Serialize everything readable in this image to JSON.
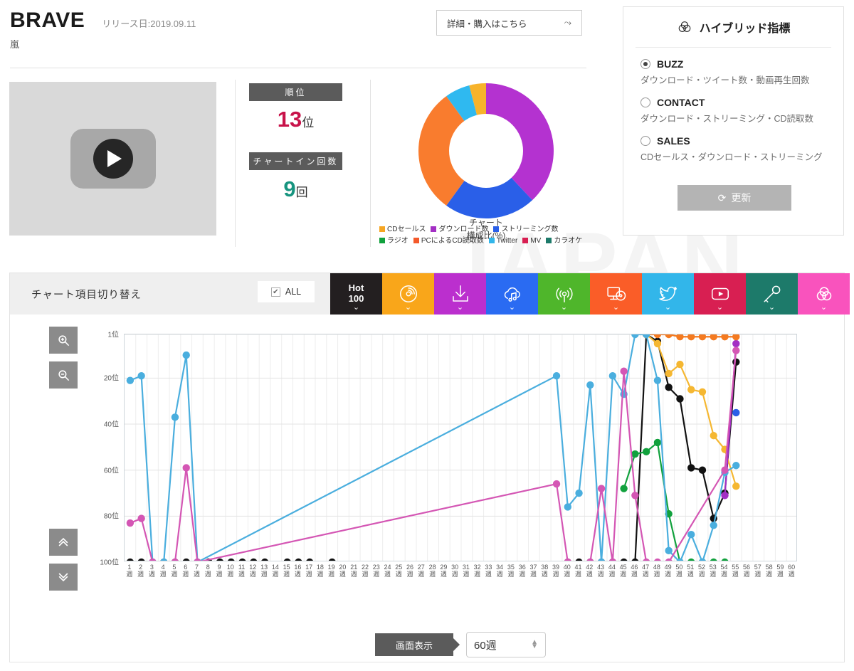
{
  "header": {
    "song_title": "BRAVE",
    "release_label": "リリース日:2019.09.11",
    "artist": "嵐",
    "buy_button": "詳細・購入はこちら",
    "buy_arrow": "⤳"
  },
  "stats": {
    "rank_label": "順位",
    "rank_number": "13",
    "rank_unit": "位",
    "chartin_label": "チャートイン回数",
    "chartin_number": "9",
    "chartin_unit": "回"
  },
  "donut": {
    "center_line1": "チャート",
    "center_line2": "構成比(%)"
  },
  "hybrid": {
    "title": "ハイブリッド指標",
    "options": [
      {
        "label": "BUZZ",
        "desc": "ダウンロード・ツイート数・動画再生回数",
        "selected": true
      },
      {
        "label": "CONTACT",
        "desc": "ダウンロード・ストリーミング・CD読取数",
        "selected": false
      },
      {
        "label": "SALES",
        "desc": "CDセールス・ダウンロード・ストリーミング",
        "selected": false
      }
    ],
    "update_button": "更新"
  },
  "panel": {
    "title": "チャート項目切り替え",
    "all_label": "ALL",
    "tabs": [
      {
        "name": "hot100",
        "caption": "Hot\n100",
        "icon": "hot100-icon",
        "color": "#231f20"
      },
      {
        "name": "cdsales",
        "caption": "",
        "icon": "record-icon",
        "color": "#f9a61a"
      },
      {
        "name": "download",
        "caption": "",
        "icon": "download-icon",
        "color": "#bb2fce"
      },
      {
        "name": "streaming",
        "caption": "",
        "icon": "cloud-music-icon",
        "color": "#2a6bf2"
      },
      {
        "name": "radio",
        "caption": "",
        "icon": "radio-icon",
        "color": "#4fb62b"
      },
      {
        "name": "pccd",
        "caption": "",
        "icon": "pc-cd-icon",
        "color": "#fa5d28"
      },
      {
        "name": "twitter",
        "caption": "",
        "icon": "twitter-icon",
        "color": "#32b6ea"
      },
      {
        "name": "mv",
        "caption": "",
        "icon": "youtube-icon",
        "color": "#d81f52"
      },
      {
        "name": "karaoke",
        "caption": "",
        "icon": "microphone-icon",
        "color": "#1d7a6a"
      },
      {
        "name": "hybrid",
        "caption": "",
        "icon": "venn-icon",
        "color": "#f953bd"
      }
    ],
    "zoom_in": "zoom-in",
    "zoom_out": "zoom-out",
    "scroll_up": "⌃⌃",
    "scroll_down": "⌄⌄",
    "pager_first": "«",
    "pager_prev": "‹",
    "pager_next": "›",
    "pager_last": "»",
    "display_label": "画面表示",
    "display_value": "60週"
  },
  "chart_data": {
    "type": "line",
    "title": "",
    "xlabel": "",
    "ylabel": "",
    "grid": true,
    "legend_position": "above (tab strip)",
    "ylim": [
      1,
      100
    ],
    "y_inverted": true,
    "yticks": [
      1,
      20,
      40,
      60,
      80,
      100
    ],
    "ytick_labels": [
      "1位",
      "20位",
      "40位",
      "60位",
      "80位",
      "100位"
    ],
    "x": [
      1,
      2,
      3,
      4,
      5,
      6,
      7,
      8,
      9,
      10,
      11,
      12,
      13,
      14,
      15,
      16,
      17,
      18,
      19,
      20,
      21,
      22,
      23,
      24,
      25,
      26,
      27,
      28,
      29,
      30,
      31,
      32,
      33,
      34,
      35,
      36,
      37,
      38,
      39,
      40,
      41,
      42,
      43,
      44,
      45,
      46,
      47,
      48,
      49,
      50,
      51,
      52,
      53,
      54,
      55,
      56,
      57,
      58,
      59,
      60
    ],
    "xtick_labels": [
      "1週",
      "2週",
      "3週",
      "4週",
      "5週",
      "6週",
      "7週",
      "8週",
      "9週",
      "10週",
      "11週",
      "12週",
      "13週",
      "14週",
      "15週",
      "16週",
      "17週",
      "18週",
      "19週",
      "20週",
      "21週",
      "22週",
      "23週",
      "24週",
      "25週",
      "26週",
      "27週",
      "28週",
      "29週",
      "30週",
      "31週",
      "32週",
      "33週",
      "34週",
      "35週",
      "36週",
      "37週",
      "38週",
      "39週",
      "40週",
      "41週",
      "42週",
      "43週",
      "44週",
      "45週",
      "46週",
      "47週",
      "48週",
      "49週",
      "50週",
      "51週",
      "52週",
      "53週",
      "54週",
      "55週",
      "56週",
      "57週",
      "58週",
      "59週",
      "60週"
    ],
    "series": [
      {
        "name": "Hot 100",
        "color": "#111111",
        "points": [
          [
            1,
            100
          ],
          [
            2,
            100
          ],
          [
            3,
            100
          ],
          [
            4,
            100
          ],
          [
            5,
            100
          ],
          [
            6,
            100
          ],
          [
            7,
            100
          ],
          [
            8,
            100
          ],
          [
            9,
            100
          ],
          [
            10,
            100
          ],
          [
            11,
            100
          ],
          [
            12,
            100
          ],
          [
            13,
            100
          ],
          [
            15,
            100
          ],
          [
            16,
            100
          ],
          [
            17,
            100
          ],
          [
            19,
            100
          ],
          [
            40,
            100
          ],
          [
            41,
            100
          ],
          [
            42,
            100
          ],
          [
            43,
            100
          ],
          [
            44,
            100
          ],
          [
            45,
            100
          ],
          [
            46,
            100
          ],
          [
            47,
            1
          ],
          [
            48,
            4
          ],
          [
            49,
            24
          ],
          [
            50,
            29
          ],
          [
            51,
            59
          ],
          [
            52,
            60
          ],
          [
            53,
            81
          ],
          [
            54,
            70
          ],
          [
            55,
            13
          ]
        ]
      },
      {
        "name": "CDセールス",
        "color": "#f5b731",
        "points": [
          [
            47,
            1
          ],
          [
            48,
            5
          ],
          [
            49,
            18
          ],
          [
            50,
            14
          ],
          [
            51,
            25
          ],
          [
            52,
            26
          ],
          [
            53,
            45
          ],
          [
            54,
            51
          ],
          [
            55,
            67
          ]
        ]
      },
      {
        "name": "ダウンロード数",
        "color": "#a32fc4",
        "points": [
          [
            54,
            71
          ],
          [
            55,
            5
          ]
        ]
      },
      {
        "name": "ストリーミング数",
        "color": "#2a5fe8",
        "points": [
          [
            55,
            35
          ]
        ]
      },
      {
        "name": "ラジオ",
        "color": "#11a13d",
        "points": [
          [
            45,
            68
          ],
          [
            46,
            53
          ],
          [
            47,
            52
          ],
          [
            48,
            48
          ],
          [
            49,
            79
          ],
          [
            50,
            100
          ],
          [
            51,
            100
          ],
          [
            52,
            100
          ],
          [
            53,
            100
          ],
          [
            54,
            100
          ]
        ]
      },
      {
        "name": "PCによるCD読取数",
        "color": "#f47a20",
        "points": [
          [
            47,
            1
          ],
          [
            48,
            1
          ],
          [
            49,
            1
          ],
          [
            50,
            2
          ],
          [
            51,
            2
          ],
          [
            52,
            2
          ],
          [
            53,
            2
          ],
          [
            54,
            2
          ],
          [
            55,
            2
          ]
        ]
      },
      {
        "name": "Twitter",
        "color": "#4aaede",
        "points": [
          [
            1,
            21
          ],
          [
            2,
            19
          ],
          [
            3,
            100
          ],
          [
            4,
            100
          ],
          [
            5,
            37
          ],
          [
            6,
            10
          ],
          [
            7,
            100
          ],
          [
            39,
            19
          ],
          [
            40,
            76
          ],
          [
            41,
            70
          ],
          [
            42,
            23
          ],
          [
            43,
            100
          ],
          [
            44,
            19
          ],
          [
            45,
            27
          ],
          [
            46,
            1
          ],
          [
            47,
            1
          ],
          [
            48,
            21
          ],
          [
            49,
            95
          ],
          [
            50,
            100
          ],
          [
            51,
            88
          ],
          [
            52,
            100
          ],
          [
            53,
            84
          ],
          [
            54,
            61
          ],
          [
            55,
            58
          ]
        ]
      },
      {
        "name": "MV",
        "color": "#d456b4",
        "points": [
          [
            1,
            83
          ],
          [
            2,
            81
          ],
          [
            3,
            100
          ],
          [
            5,
            100
          ],
          [
            6,
            59
          ],
          [
            7,
            100
          ],
          [
            39,
            66
          ],
          [
            40,
            100
          ],
          [
            42,
            100
          ],
          [
            43,
            68
          ],
          [
            44,
            100
          ],
          [
            45,
            17
          ],
          [
            46,
            71
          ],
          [
            47,
            100
          ],
          [
            48,
            100
          ],
          [
            49,
            100
          ],
          [
            54,
            60
          ],
          [
            55,
            8
          ]
        ]
      }
    ]
  },
  "legend": {
    "items": [
      {
        "label": "CDセールス",
        "color": "#f6a623"
      },
      {
        "label": "ダウンロード数",
        "color": "#a32fc4"
      },
      {
        "label": "ストリーミング数",
        "color": "#2a5fe8"
      },
      {
        "label": "ラジオ",
        "color": "#11a13d"
      },
      {
        "label": "PCによるCD読取数",
        "color": "#f4592a"
      },
      {
        "label": "Twitter",
        "color": "#32b6ea"
      },
      {
        "label": "MV",
        "color": "#d81f52"
      },
      {
        "label": "カラオケ",
        "color": "#1d7a6a"
      }
    ]
  },
  "donut_chart": {
    "type": "pie",
    "title": "チャート構成比(%)",
    "labels": [
      "ダウンロード数",
      "ストリーミング数",
      "PCによるCD読取数",
      "Twitter",
      "CDセールス"
    ],
    "values": [
      38,
      22,
      30,
      6,
      4
    ],
    "colors": [
      "#b432d0",
      "#2a5fe8",
      "#f97c2e",
      "#2fb9f0",
      "#f7b32b"
    ]
  },
  "watermark": "JAPAN"
}
